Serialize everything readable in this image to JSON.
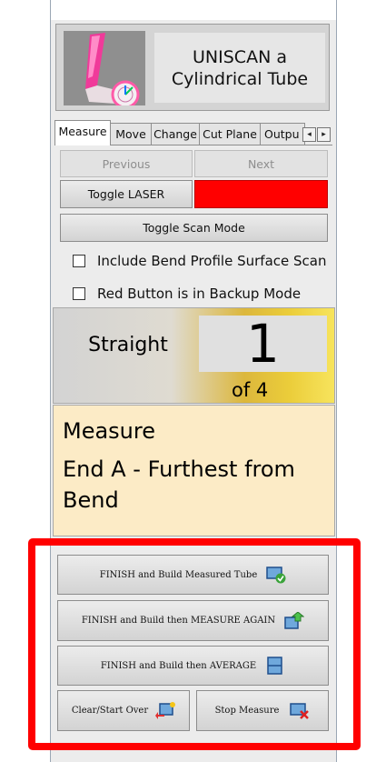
{
  "header": {
    "title": "UNISCAN a\nCylindrical Tube"
  },
  "tabs": [
    "Measure",
    "Move",
    "Change",
    "Cut Plane",
    "Outpu"
  ],
  "nav": {
    "previous": "Previous",
    "next": "Next"
  },
  "laser": {
    "toggle_label": "Toggle LASER",
    "status_color": "#ff0000"
  },
  "scan_mode": {
    "toggle_label": "Toggle Scan Mode"
  },
  "options": {
    "bend_profile": "Include Bend Profile Surface Scan",
    "backup_mode": "Red Button is in Backup Mode"
  },
  "progress": {
    "segment": "Straight",
    "index": "1",
    "of_text": "of 4"
  },
  "instruction": {
    "title": "Measure",
    "detail": "End A - Furthest from Bend"
  },
  "actions": {
    "finish_build": "FINISH and Build Measured Tube",
    "finish_measure_again": "FINISH and Build then MEASURE AGAIN",
    "finish_average": "FINISH and Build then AVERAGE",
    "clear": "Clear/Start Over",
    "stop": "Stop Measure"
  },
  "icons": [
    "tube-check-icon",
    "tube-up-arrow-icon",
    "tube-average-icon",
    "tube-clear-icon",
    "tube-stop-icon"
  ],
  "colors": {
    "laser_off": "#ff0000",
    "highlight_frame": "#ff0000",
    "instruction_bg": "#fcebc6"
  }
}
